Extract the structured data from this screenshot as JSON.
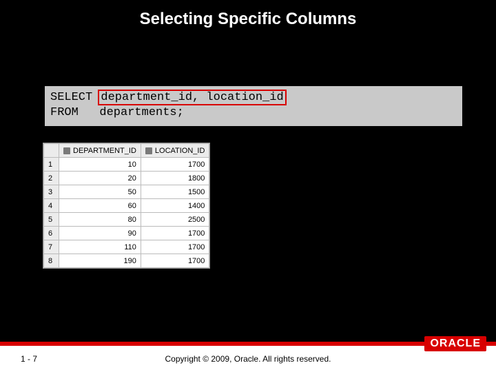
{
  "title": "Selecting Specific Columns",
  "sql": {
    "keyword_select": "SELECT",
    "cols_highlighted": "department_id, location_id",
    "keyword_from": "FROM",
    "table_clause": "departments;"
  },
  "result": {
    "columns": [
      "DEPARTMENT_ID",
      "LOCATION_ID"
    ],
    "rows": [
      {
        "n": "1",
        "dept": "10",
        "loc": "1700"
      },
      {
        "n": "2",
        "dept": "20",
        "loc": "1800"
      },
      {
        "n": "3",
        "dept": "50",
        "loc": "1500"
      },
      {
        "n": "4",
        "dept": "60",
        "loc": "1400"
      },
      {
        "n": "5",
        "dept": "80",
        "loc": "2500"
      },
      {
        "n": "6",
        "dept": "90",
        "loc": "1700"
      },
      {
        "n": "7",
        "dept": "110",
        "loc": "1700"
      },
      {
        "n": "8",
        "dept": "190",
        "loc": "1700"
      }
    ]
  },
  "footer": {
    "page": "1 - 7",
    "copyright": "Copyright © 2009, Oracle. All rights reserved.",
    "logo": "ORACLE"
  }
}
